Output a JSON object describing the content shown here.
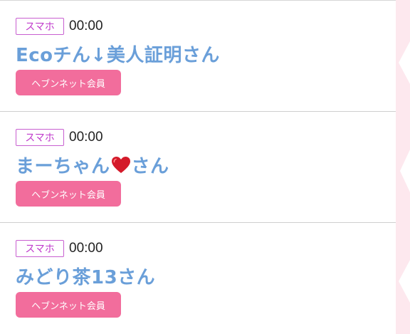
{
  "entries": [
    {
      "device": "スマホ",
      "time": "00:00",
      "name_before": "Ecoチん↓美人証明さん",
      "has_heart": false,
      "name_after": "",
      "member_label": "ヘブンネット会員"
    },
    {
      "device": "スマホ",
      "time": "00:00",
      "name_before": "まーちゃん",
      "has_heart": true,
      "name_after": "さん",
      "member_label": "ヘブンネット会員"
    },
    {
      "device": "スマホ",
      "time": "00:00",
      "name_before": "みどり茶13さん",
      "has_heart": false,
      "name_after": "",
      "member_label": "ヘブンネット会員"
    }
  ],
  "colors": {
    "name": "#6a9fd9",
    "button": "#f26d9c",
    "tag_border": "#c85fd0",
    "decor": "#fde8ee"
  }
}
